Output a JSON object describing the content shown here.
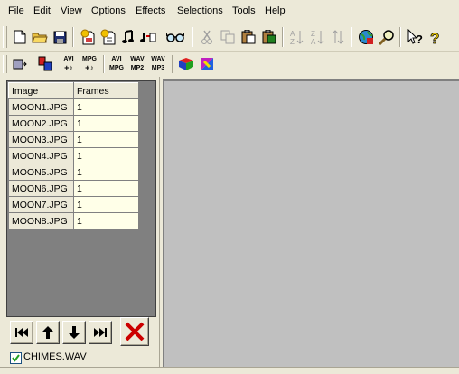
{
  "menu": [
    "File",
    "Edit",
    "View",
    "Options",
    "Effects",
    "Selections",
    "Tools",
    "Help"
  ],
  "toolbar2_labels": {
    "avi_music": [
      "AVI",
      "+♪"
    ],
    "mpg_music": [
      "MPG",
      "+♪"
    ],
    "avi_mpg": [
      "AVI",
      "MPG"
    ],
    "wav_mp2": [
      "WAV",
      "MP2"
    ],
    "wav_mp3": [
      "WAV",
      "MP3"
    ]
  },
  "grid": {
    "headers": [
      "Image",
      "Frames"
    ],
    "rows": [
      {
        "image": "MOON1.JPG",
        "frames": "1"
      },
      {
        "image": "MOON2.JPG",
        "frames": "1"
      },
      {
        "image": "MOON3.JPG",
        "frames": "1"
      },
      {
        "image": "MOON4.JPG",
        "frames": "1"
      },
      {
        "image": "MOON5.JPG",
        "frames": "1"
      },
      {
        "image": "MOON6.JPG",
        "frames": "1"
      },
      {
        "image": "MOON7.JPG",
        "frames": "1"
      },
      {
        "image": "MOON8.JPG",
        "frames": "1"
      }
    ]
  },
  "sound": {
    "checked": true,
    "label": "CHIMES.WAV"
  },
  "colors": {
    "panel": "#ece9d8",
    "canvas": "#c0c0c0",
    "frames_cell": "#ffffe8",
    "delete_red": "#cc0000"
  }
}
